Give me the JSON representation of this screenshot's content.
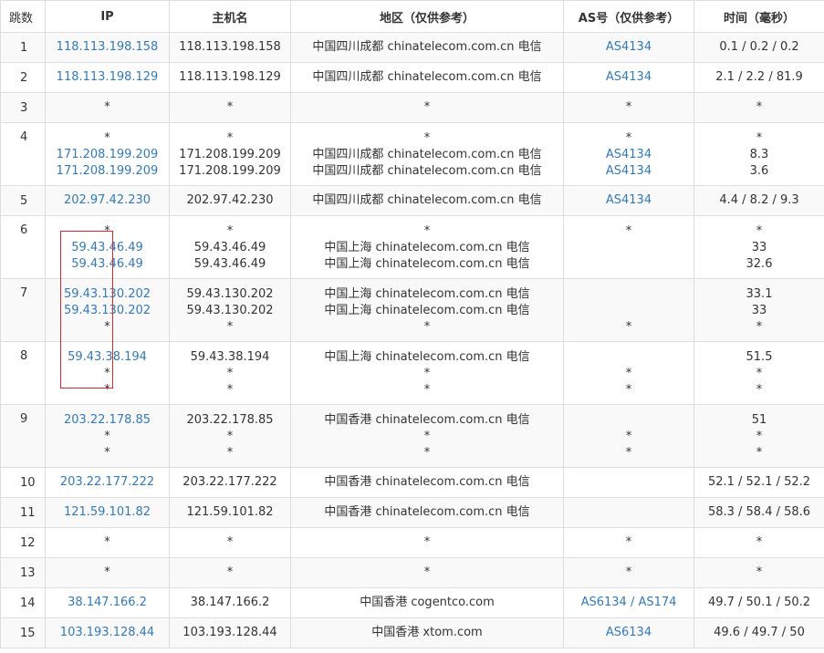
{
  "headers": [
    "跳数",
    "IP",
    "主机名",
    "地区（仅供参考）",
    "AS号（仅供参考）",
    "时间（毫秒）"
  ],
  "rows": [
    {
      "hop": "1",
      "ip": [
        "118.113.198.158"
      ],
      "host": [
        "118.113.198.158"
      ],
      "region": [
        "中国四川成都 chinatelecom.com.cn 电信"
      ],
      "asn": [
        "AS4134"
      ],
      "time": [
        "0.1 / 0.2 / 0.2"
      ]
    },
    {
      "hop": "2",
      "ip": [
        "118.113.198.129"
      ],
      "host": [
        "118.113.198.129"
      ],
      "region": [
        "中国四川成都 chinatelecom.com.cn 电信"
      ],
      "asn": [
        "AS4134"
      ],
      "time": [
        "2.1 / 2.2 / 81.9"
      ]
    },
    {
      "hop": "3",
      "ip": [
        "*"
      ],
      "host": [
        "*"
      ],
      "region": [
        "*"
      ],
      "asn": [
        "*"
      ],
      "time": [
        "*"
      ]
    },
    {
      "hop": "4",
      "ip": [
        "*",
        "171.208.199.209",
        "171.208.199.209"
      ],
      "host": [
        "*",
        "171.208.199.209",
        "171.208.199.209"
      ],
      "region": [
        "*",
        "中国四川成都 chinatelecom.com.cn 电信",
        "中国四川成都 chinatelecom.com.cn 电信"
      ],
      "asn": [
        "*",
        "AS4134",
        "AS4134"
      ],
      "time": [
        "*",
        "8.3",
        "3.6"
      ]
    },
    {
      "hop": "5",
      "ip": [
        "202.97.42.230"
      ],
      "host": [
        "202.97.42.230"
      ],
      "region": [
        "中国四川成都 chinatelecom.com.cn 电信"
      ],
      "asn": [
        "AS4134"
      ],
      "time": [
        "4.4 / 8.2 / 9.3"
      ]
    },
    {
      "hop": "6",
      "ip": [
        "*",
        "59.43.46.49",
        "59.43.46.49"
      ],
      "host": [
        "*",
        "59.43.46.49",
        "59.43.46.49"
      ],
      "region": [
        "*",
        "中国上海 chinatelecom.com.cn 电信",
        "中国上海 chinatelecom.com.cn 电信"
      ],
      "asn": [
        "*",
        "",
        ""
      ],
      "time": [
        "*",
        "33",
        "32.6"
      ]
    },
    {
      "hop": "7",
      "ip": [
        "59.43.130.202",
        "59.43.130.202",
        "*"
      ],
      "host": [
        "59.43.130.202",
        "59.43.130.202",
        "*"
      ],
      "region": [
        "中国上海 chinatelecom.com.cn 电信",
        "中国上海 chinatelecom.com.cn 电信",
        "*"
      ],
      "asn": [
        "",
        "",
        "*"
      ],
      "time": [
        "33.1",
        "33",
        "*"
      ]
    },
    {
      "hop": "8",
      "ip": [
        "59.43.38.194",
        "*",
        "*"
      ],
      "host": [
        "59.43.38.194",
        "*",
        "*"
      ],
      "region": [
        "中国上海 chinatelecom.com.cn 电信",
        "*",
        "*"
      ],
      "asn": [
        "",
        "*",
        "*"
      ],
      "time": [
        "51.5",
        "*",
        "*"
      ]
    },
    {
      "hop": "9",
      "ip": [
        "203.22.178.85",
        "*",
        "*"
      ],
      "host": [
        "203.22.178.85",
        "*",
        "*"
      ],
      "region": [
        "中国香港 chinatelecom.com.cn 电信",
        "*",
        "*"
      ],
      "asn": [
        "",
        "*",
        "*"
      ],
      "time": [
        "51",
        "*",
        "*"
      ]
    },
    {
      "hop": "10",
      "ip": [
        "203.22.177.222"
      ],
      "host": [
        "203.22.177.222"
      ],
      "region": [
        "中国香港 chinatelecom.com.cn 电信"
      ],
      "asn": [
        ""
      ],
      "time": [
        "52.1 / 52.1 / 52.2"
      ]
    },
    {
      "hop": "11",
      "ip": [
        "121.59.101.82"
      ],
      "host": [
        "121.59.101.82"
      ],
      "region": [
        "中国香港 chinatelecom.com.cn 电信"
      ],
      "asn": [
        ""
      ],
      "time": [
        "58.3 / 58.4 / 58.6"
      ]
    },
    {
      "hop": "12",
      "ip": [
        "*"
      ],
      "host": [
        "*"
      ],
      "region": [
        "*"
      ],
      "asn": [
        "*"
      ],
      "time": [
        "*"
      ]
    },
    {
      "hop": "13",
      "ip": [
        "*"
      ],
      "host": [
        "*"
      ],
      "region": [
        "*"
      ],
      "asn": [
        "*"
      ],
      "time": [
        "*"
      ]
    },
    {
      "hop": "14",
      "ip": [
        "38.147.166.2"
      ],
      "host": [
        "38.147.166.2"
      ],
      "region": [
        "中国香港 cogentco.com"
      ],
      "asn": [
        "AS6134 / AS174"
      ],
      "time": [
        "49.7 / 50.1 / 50.2"
      ]
    },
    {
      "hop": "15",
      "ip": [
        "103.193.128.44"
      ],
      "host": [
        "103.193.128.44"
      ],
      "region": [
        "中国香港 xtom.com"
      ],
      "asn": [
        "AS6134"
      ],
      "time": [
        "49.6 / 49.7 / 50"
      ]
    }
  ],
  "colors": {
    "link": "#337ab7",
    "highlight": "#d62b2b",
    "border": "#dddddd",
    "stripe": "#f9f9f9"
  }
}
